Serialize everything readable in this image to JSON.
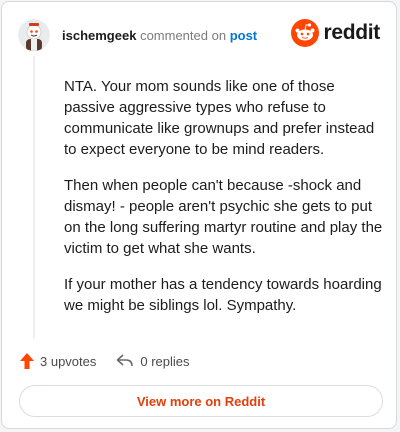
{
  "header": {
    "username": "ischemgeek",
    "commented_on": "commented on",
    "post_link": "post",
    "brand": "reddit"
  },
  "comment": {
    "paragraphs": [
      "NTA. Your mom sounds like one of those passive aggressive types who refuse to communicate like grownups and prefer instead to expect everyone to be mind readers.",
      "Then when people can't because -shock and dismay! - people aren't psychic she gets to put on the long suffering martyr routine and play the victim to get what she wants.",
      "If your mother has a tendency towards hoarding we might be siblings lol. Sympathy."
    ]
  },
  "actions": {
    "upvotes": "3 upvotes",
    "replies": "0 replies"
  },
  "footer": {
    "view_more": "View more on Reddit"
  },
  "colors": {
    "accent": "#ff4500",
    "link": "#0079d3",
    "button_text": "#e53e0a"
  },
  "icons": [
    "avatar",
    "reddit-logo-icon",
    "upvote-arrow-icon",
    "reply-icon"
  ]
}
